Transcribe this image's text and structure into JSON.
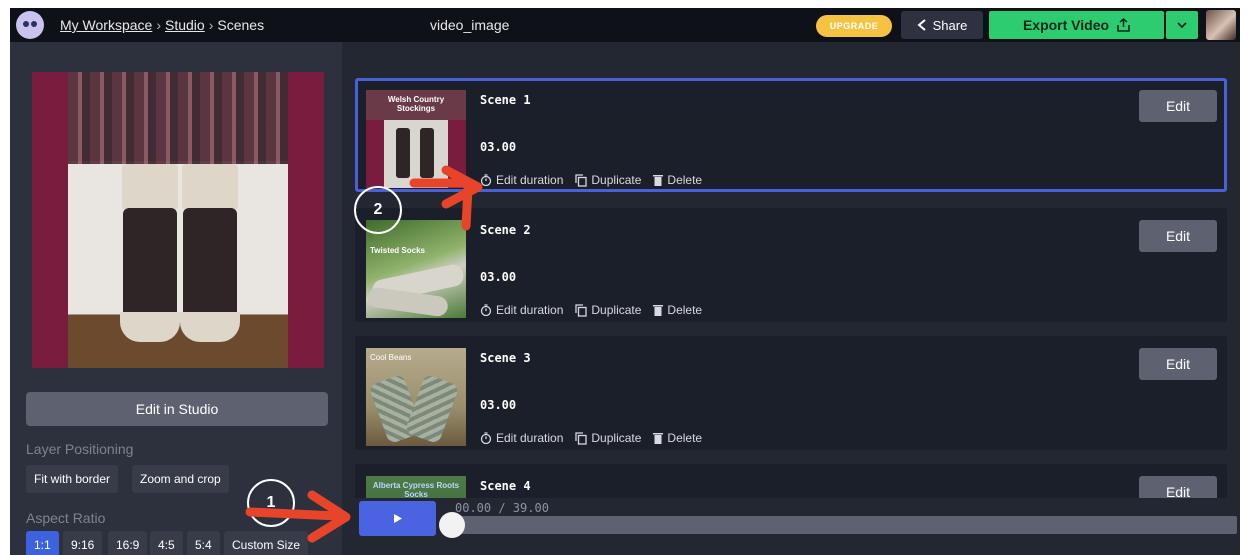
{
  "topbar": {
    "breadcrumb": [
      "My Workspace",
      "Studio",
      "Scenes"
    ],
    "separator": "›",
    "doc_title": "video_image",
    "upgrade_label": "UPGRADE",
    "share_label": "Share",
    "export_label": "Export Video"
  },
  "left_panel": {
    "edit_in_studio_label": "Edit in Studio",
    "layer_positioning_label": "Layer Positioning",
    "layer_options": [
      "Fit with border",
      "Zoom and crop"
    ],
    "aspect_ratio_label": "Aspect Ratio",
    "aspect_options": [
      "1:1",
      "9:16",
      "16:9",
      "4:5",
      "5:4",
      "Custom Size"
    ],
    "aspect_selected": "1:1"
  },
  "scenes": [
    {
      "title": "Scene 1",
      "duration": "03.00",
      "caption": "Welsh Country Stockings",
      "selected": true
    },
    {
      "title": "Scene 2",
      "duration": "03.00",
      "caption": "Twisted Socks",
      "selected": false
    },
    {
      "title": "Scene 3",
      "duration": "03.00",
      "caption": "Cool Beans",
      "selected": false
    },
    {
      "title": "Scene 4",
      "duration": "",
      "caption": "Alberta Cypress Roots Socks",
      "selected": false
    }
  ],
  "scene_actions": {
    "edit_duration": "Edit duration",
    "duplicate": "Duplicate",
    "delete": "Delete",
    "edit": "Edit"
  },
  "playbar": {
    "timecode": "00.00 / 39.00"
  },
  "annotations": {
    "marker_1": "1",
    "marker_2": "2"
  },
  "colors": {
    "accent_blue": "#4a63e0",
    "export_green": "#2ecc71",
    "upgrade_yellow": "#f5c242",
    "annotation_red": "#e8442a"
  }
}
